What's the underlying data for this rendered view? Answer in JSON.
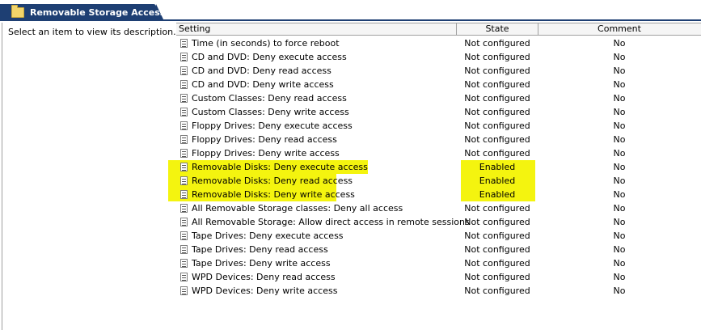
{
  "window": {
    "title": "Removable Storage Access",
    "icon": "folder-icon"
  },
  "left_pane": {
    "description": "Select an item to view its description."
  },
  "table": {
    "columns": {
      "setting": "Setting",
      "state": "State",
      "comment": "Comment"
    },
    "rows": [
      {
        "setting": "Time (in seconds) to force reboot",
        "state": "Not configured",
        "comment": "No",
        "highlighted": false
      },
      {
        "setting": "CD and DVD: Deny execute access",
        "state": "Not configured",
        "comment": "No",
        "highlighted": false
      },
      {
        "setting": "CD and DVD: Deny read access",
        "state": "Not configured",
        "comment": "No",
        "highlighted": false
      },
      {
        "setting": "CD and DVD: Deny write access",
        "state": "Not configured",
        "comment": "No",
        "highlighted": false
      },
      {
        "setting": "Custom Classes: Deny read access",
        "state": "Not configured",
        "comment": "No",
        "highlighted": false
      },
      {
        "setting": "Custom Classes: Deny write access",
        "state": "Not configured",
        "comment": "No",
        "highlighted": false
      },
      {
        "setting": "Floppy Drives: Deny execute access",
        "state": "Not configured",
        "comment": "No",
        "highlighted": false
      },
      {
        "setting": "Floppy Drives: Deny read access",
        "state": "Not configured",
        "comment": "No",
        "highlighted": false
      },
      {
        "setting": "Floppy Drives: Deny write access",
        "state": "Not configured",
        "comment": "No",
        "highlighted": false
      },
      {
        "setting": "Removable Disks: Deny execute access",
        "state": "Enabled",
        "comment": "No",
        "highlighted": true
      },
      {
        "setting": "Removable Disks: Deny read access",
        "state": "Enabled",
        "comment": "No",
        "highlighted": true
      },
      {
        "setting": "Removable Disks: Deny write access",
        "state": "Enabled",
        "comment": "No",
        "highlighted": true
      },
      {
        "setting": "All Removable Storage classes: Deny all access",
        "state": "Not configured",
        "comment": "No",
        "highlighted": false
      },
      {
        "setting": "All Removable Storage: Allow direct access in remote sessions",
        "state": "Not configured",
        "comment": "No",
        "highlighted": false
      },
      {
        "setting": "Tape Drives: Deny execute access",
        "state": "Not configured",
        "comment": "No",
        "highlighted": false
      },
      {
        "setting": "Tape Drives: Deny read access",
        "state": "Not configured",
        "comment": "No",
        "highlighted": false
      },
      {
        "setting": "Tape Drives: Deny write access",
        "state": "Not configured",
        "comment": "No",
        "highlighted": false
      },
      {
        "setting": "WPD Devices: Deny read access",
        "state": "Not configured",
        "comment": "No",
        "highlighted": false
      },
      {
        "setting": "WPD Devices: Deny write access",
        "state": "Not configured",
        "comment": "No",
        "highlighted": false
      }
    ]
  },
  "colors": {
    "title_bar": "#1e3f73",
    "highlight": "#f4f40f"
  }
}
